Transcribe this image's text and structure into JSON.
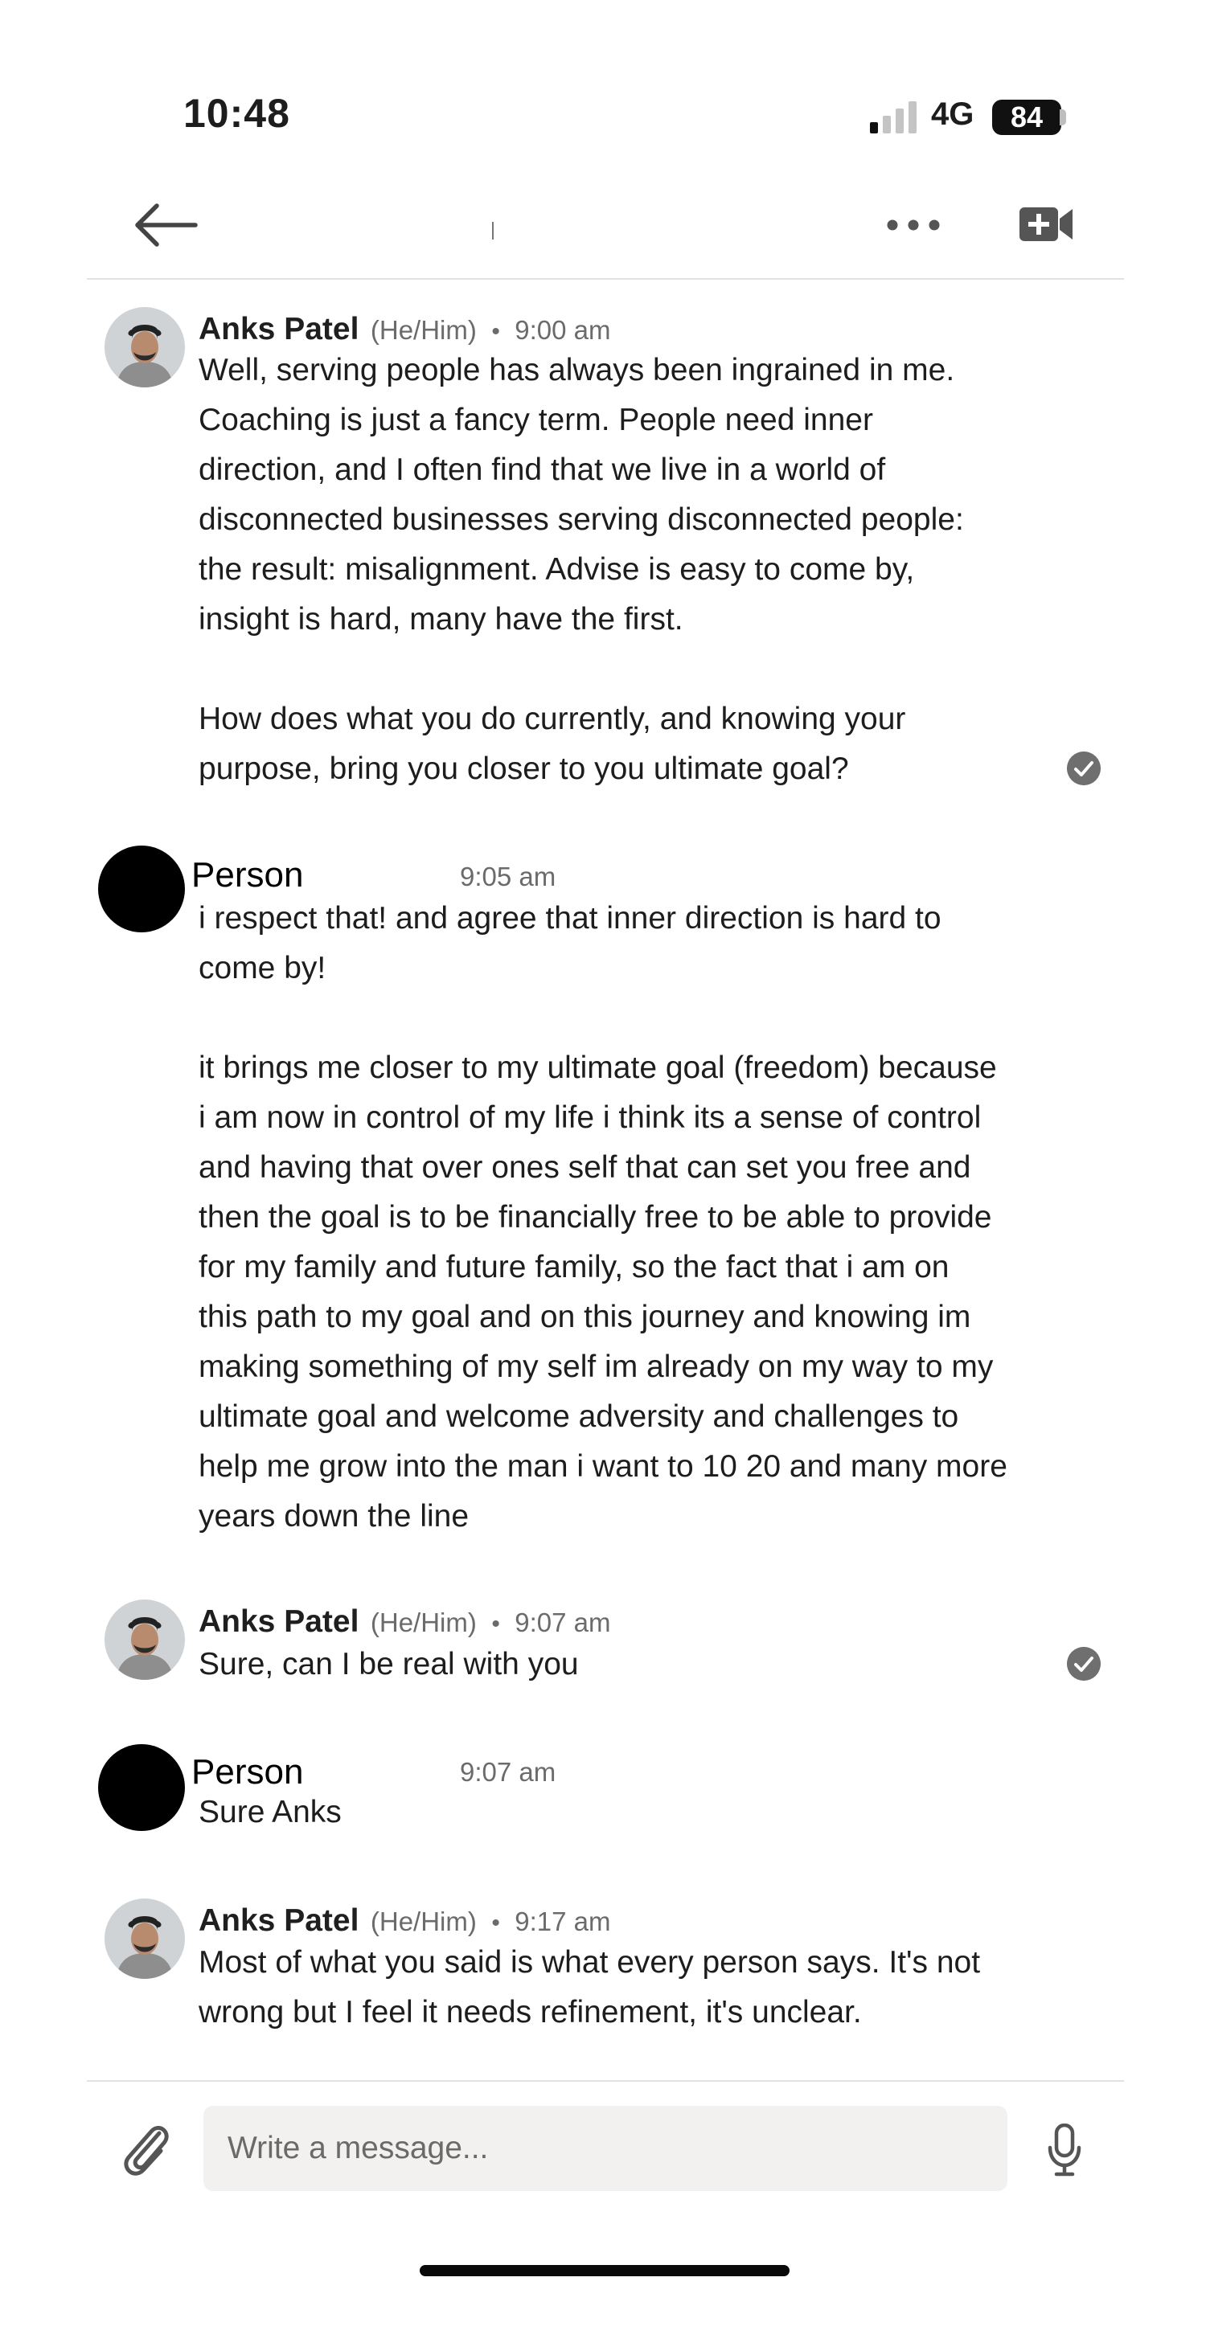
{
  "status_bar": {
    "time": "10:48",
    "network": "4G",
    "battery": "84"
  },
  "header": {
    "back_icon": "arrow-left-icon",
    "more_icon": "ellipsis-icon",
    "video_icon": "video-plus-icon"
  },
  "messages": [
    {
      "sender": "Anks Patel",
      "pronouns": "(He/Him)",
      "separator": "•",
      "time": "9:00 am",
      "text": "Well, serving people has always been ingrained in me.\nCoaching is just a fancy term. People need inner\ndirection, and I often find that we live in a world of\ndisconnected businesses serving disconnected people:\nthe result: misalignment. Advise is easy to come by,\ninsight is hard, many have the first.\n\nHow does what you do currently, and knowing your\npurpose, bring you closer to you ultimate goal?",
      "read": true
    },
    {
      "sender": "Person",
      "time": "9:05 am",
      "text": "i respect that! and agree that inner direction is hard to\ncome by!\n\nit brings me closer to my ultimate goal (freedom) because\ni am now in control of my life i think its a sense of control\nand having that over ones self that can set you free and\nthen the goal is to be financially free to be able to provide\nfor my family and future family, so the fact that i am on\nthis path to my goal and on this journey and knowing im\nmaking something of my self im already on my way to my\nultimate goal and welcome adversity and challenges to\nhelp me grow into the man i want to 10 20 and many more\nyears down the line"
    },
    {
      "sender": "Anks Patel",
      "pronouns": "(He/Him)",
      "separator": "•",
      "time": "9:07 am",
      "text": "Sure, can I be real with you",
      "read": true
    },
    {
      "sender": "Person",
      "time": "9:07 am",
      "text": "Sure Anks"
    },
    {
      "sender": "Anks Patel",
      "pronouns": "(He/Him)",
      "separator": "•",
      "time": "9:17 am",
      "text": "Most of what you said is what every person says. It's not\nwrong but I feel it needs refinement, it's unclear."
    }
  ],
  "composer": {
    "placeholder": "Write a message...",
    "attach_icon": "paperclip-icon",
    "mic_icon": "microphone-icon"
  }
}
